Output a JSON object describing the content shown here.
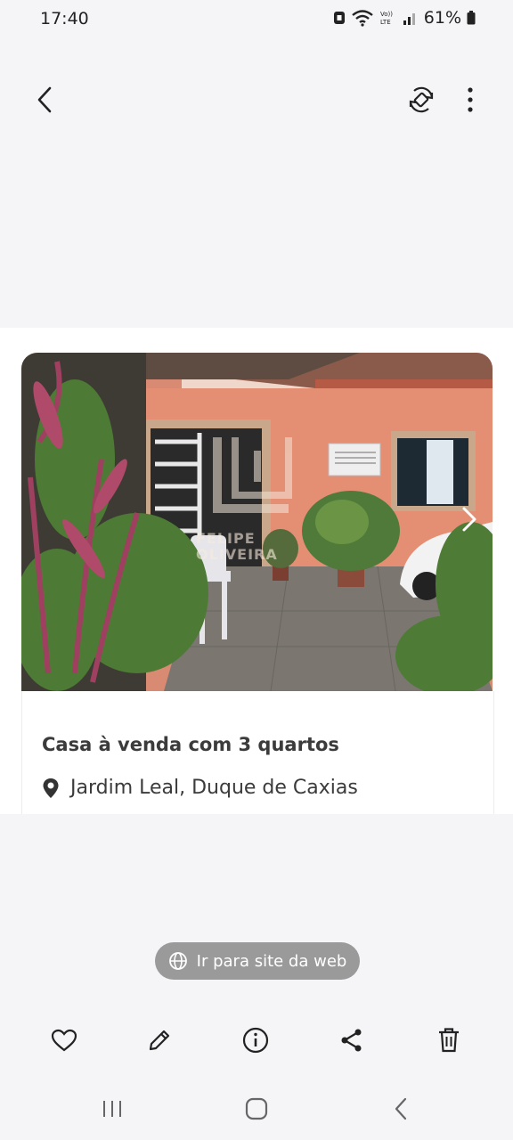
{
  "status_bar": {
    "time": "17:40",
    "battery": "61%",
    "icons": [
      "data-saver-icon",
      "wifi-icon",
      "volte-icon",
      "signal-icon",
      "battery-icon"
    ]
  },
  "top_bar": {
    "icons": [
      "back-arrow-icon",
      "rotate-icon",
      "more-options-icon"
    ]
  },
  "listing": {
    "watermark": "FELIPE OLIVEIRA",
    "title": "Casa à venda com 3 quartos",
    "location": "Jardim Leal, Duque de Caxias"
  },
  "web_chip": {
    "label": "Ir para site da web"
  },
  "action_bar": {
    "icons": [
      "favorite-heart-icon",
      "edit-pencil-icon",
      "info-icon",
      "share-icon",
      "delete-trash-icon"
    ]
  },
  "nav_bar": {
    "icons": [
      "recent-apps-icon",
      "home-icon",
      "back-icon"
    ]
  },
  "colors": {
    "background": "#f5f4f7",
    "chip": "#9a9a9b",
    "wall": "#e59277"
  }
}
